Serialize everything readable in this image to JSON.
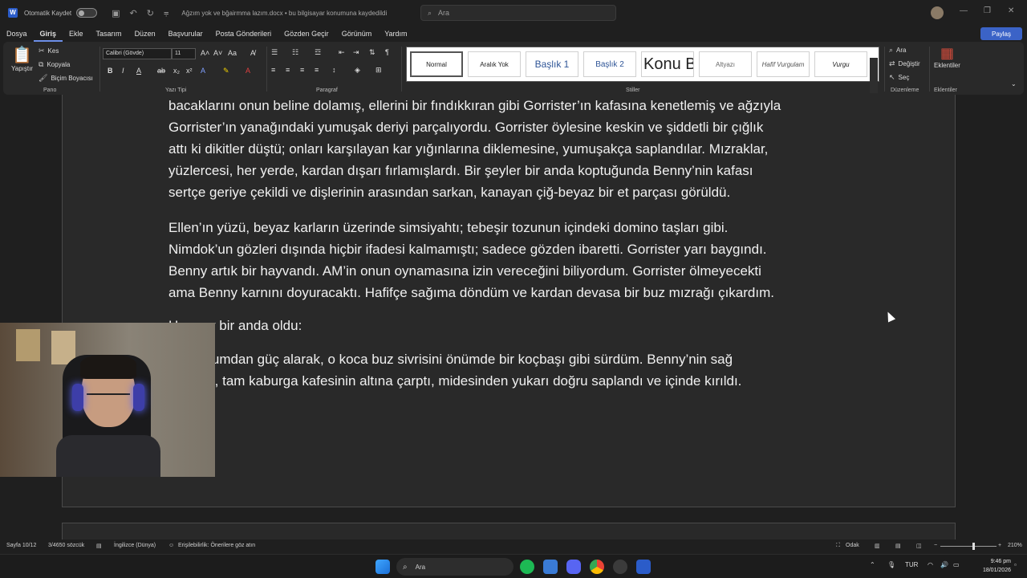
{
  "titlebar": {
    "autosave_label": "Otomatik Kaydet",
    "doc_title": "Ağzım yok  ve bğairmma lazım.docx  •  bu bilgisayar konumuna kaydedildi",
    "search_placeholder": "Ara"
  },
  "menu": [
    "Dosya",
    "Giriş",
    "Ekle",
    "Tasarım",
    "Düzen",
    "Başvurular",
    "Posta Gönderileri",
    "Gözden Geçir",
    "Görünüm",
    "Yardım"
  ],
  "share_label": "Paylaş",
  "ribbon": {
    "paste": "Yapıştır",
    "cut": "Kes",
    "copy": "Kopyala",
    "format_painter": "Biçim Boyacısı",
    "group_clipboard": "Pano",
    "font_name": "Calibri (Gövde)",
    "font_size": "11",
    "group_font": "Yazı Tipi",
    "group_paragraph": "Paragraf",
    "group_styles": "Stiller",
    "styles": [
      "Normal",
      "Aralık Yok",
      "Başlık 1",
      "Başlık 2",
      "Konu B",
      "Altyazı",
      "Hafif Vurgulam",
      "Vurgu"
    ],
    "find": "Ara",
    "replace": "Değiştir",
    "select": "Seç",
    "group_editing": "Düzenleme",
    "addins": "Eklentiler",
    "group_addins": "Eklentiler"
  },
  "document": {
    "p1": [
      "bacaklarını onun beline dolamış, ellerini bir fındıkkıran gibi Gorrister’ın kafasına kenetlemiş ve ağzıyla",
      "Gorrister’ın yanağındaki yumuşak deriyi parçalıyordu. Gorrister öylesine keskin ve şiddetli bir çığlık",
      "attı ki dikitler düştü; onları karşılayan kar yığınlarına diklemesine, yumuşakça saplandılar. Mızraklar,",
      "yüzlercesi, her yerde, kardan dışarı fırlamışlardı. Bir şeyler bir anda koptuğunda Benny’nin kafası",
      "sertçe geriye çekildi ve dişlerinin arasından sarkan, kanayan çiğ-beyaz bir et parçası görüldü."
    ],
    "p2": [
      "Ellen’ın yüzü, beyaz karların üzerinde simsiyahtı; tebeşir tozunun içindeki domino taşları gibi.",
      "Nimdok’un gözleri dışında hiçbir ifadesi kalmamıştı; sadece gözden ibaretti. Gorrister yarı baygındı.",
      "Benny artık bir hayvandı. AM’in onun oynamasına izin vereceğini biliyordum. Gorrister ölmeyecekti",
      "ama Benny karnını doyuracaktı. Hafifçe sağıma döndüm ve kardan devasa bir buz mızrağı çıkardım."
    ],
    "p3": "Her şey bir anda oldu:",
    "p4": [
      "Korkuğumdan güç alarak, o koca buz sivrisini önümde bir koçbaşı gibi sürdüm. Benny’nin sağ",
      "tarafına, tam kaburga kafesinin altına çarptı, midesinden yukarı doğru saplandı ve içinde kırıldı."
    ]
  },
  "statusbar": {
    "page": "Sayfa 10/12",
    "words": "3/4650 sözcük",
    "language": "İngilizce (Dünya)",
    "accessibility": "Erişilebilirlik: Önerilere göz atın",
    "focus": "Odak",
    "zoom": "210%"
  },
  "taskbar": {
    "search": "Ara",
    "lang": "TUR",
    "time": "9:46 pm",
    "date": "18/01/2026"
  }
}
